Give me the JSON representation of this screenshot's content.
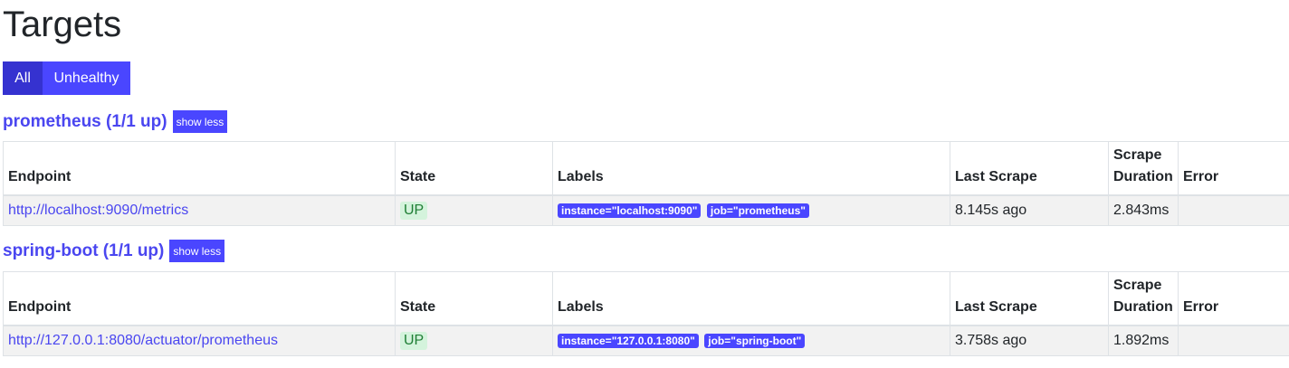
{
  "page": {
    "title": "Targets"
  },
  "filters": {
    "all_label": "All",
    "unhealthy_label": "Unhealthy"
  },
  "columns": {
    "endpoint": "Endpoint",
    "state": "State",
    "labels": "Labels",
    "last_scrape": "Last Scrape",
    "scrape_duration_line1": "Scrape",
    "scrape_duration_line2": "Duration",
    "error": "Error"
  },
  "jobs": [
    {
      "title": "prometheus (1/1 up)",
      "toggle_label": "show less",
      "targets": [
        {
          "endpoint": "http://localhost:9090/metrics",
          "state": "UP",
          "labels": [
            "instance=\"localhost:9090\"",
            "job=\"prometheus\""
          ],
          "last_scrape": "8.145s ago",
          "scrape_duration": "2.843ms",
          "error": ""
        }
      ]
    },
    {
      "title": "spring-boot (1/1 up)",
      "toggle_label": "show less",
      "targets": [
        {
          "endpoint": "http://127.0.0.1:8080/actuator/prometheus",
          "state": "UP",
          "labels": [
            "instance=\"127.0.0.1:8080\"",
            "job=\"spring-boot\""
          ],
          "last_scrape": "3.758s ago",
          "scrape_duration": "1.892ms",
          "error": ""
        }
      ]
    }
  ],
  "colors": {
    "accent": "#4a46ff",
    "accent_active": "#3532d0",
    "link": "#4a46f0",
    "state_up_bg": "#d4f3dc",
    "state_up_text": "#1e7e34"
  }
}
